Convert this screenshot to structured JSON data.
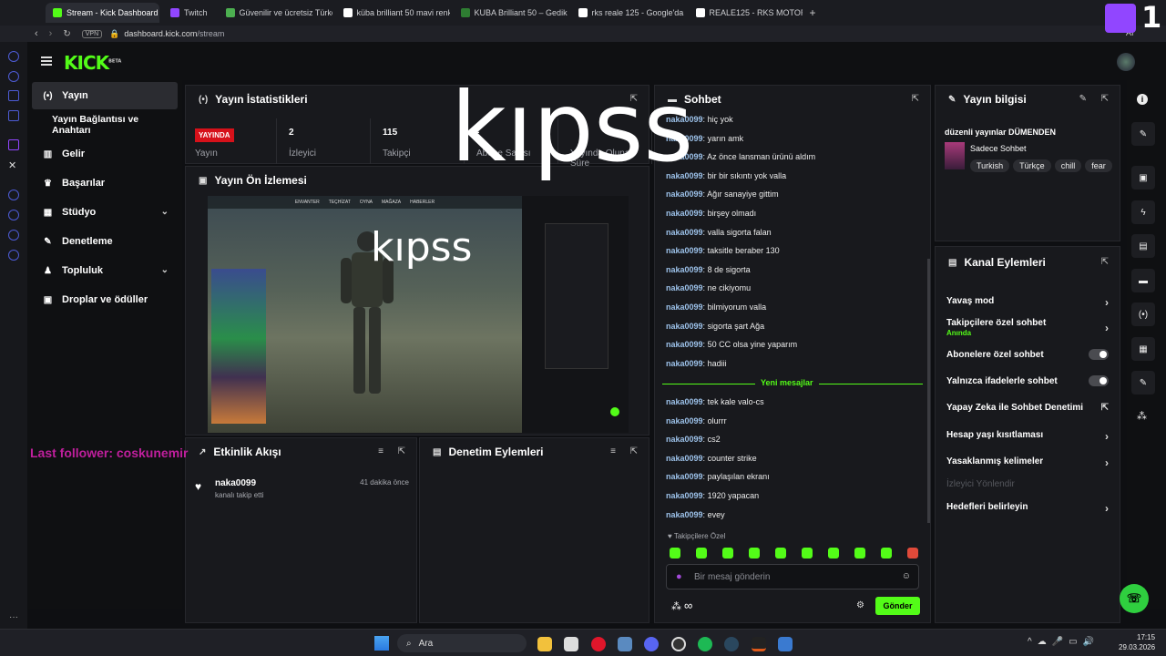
{
  "browser": {
    "tabs": [
      {
        "label": "Stream - Kick Dashboard",
        "active": true,
        "color": "#53fc18"
      },
      {
        "label": "Twitch",
        "active": false,
        "color": "#9146ff"
      },
      {
        "label": "Güvenilir ve ücretsiz Türkç",
        "active": false,
        "color": "#4caf50"
      },
      {
        "label": "küba brilliant 50 mavi renk",
        "active": false,
        "color": "#ffffff"
      },
      {
        "label": "KUBA Brilliant 50 – Gedikli",
        "active": false,
        "color": "#2e7d32"
      },
      {
        "label": "rks reale 125 - Google'da A",
        "active": false,
        "color": "#ffffff"
      },
      {
        "label": "REALE125 - RKS MOTOR",
        "active": false,
        "color": "#ffffff"
      }
    ],
    "vpn": "VPN",
    "url_host": "dashboard.kick.com",
    "url_path": "/stream",
    "ai_label": "AI"
  },
  "header": {
    "logo": "KICK",
    "beta": "BETA"
  },
  "nav": {
    "items": [
      {
        "label": "Yayın",
        "active": true,
        "icon": "broadcast-icon",
        "glyph": "(•)"
      },
      {
        "label": "Yayın Bağlantısı ve Anahtarı",
        "active": false,
        "icon": "",
        "glyph": ""
      },
      {
        "label": "Gelir",
        "active": false,
        "icon": "revenue-icon",
        "glyph": "▥"
      },
      {
        "label": "Başarılar",
        "active": false,
        "icon": "trophy-icon",
        "glyph": "♛"
      },
      {
        "label": "Stüdyo",
        "active": false,
        "icon": "studio-icon",
        "glyph": "▦",
        "chevron": "⌄"
      },
      {
        "label": "Denetleme",
        "active": false,
        "icon": "wrench-icon",
        "glyph": "✎"
      },
      {
        "label": "Topluluk",
        "active": false,
        "icon": "community-icon",
        "glyph": "♟",
        "chevron": "⌄"
      },
      {
        "label": "Droplar ve ödüller",
        "active": false,
        "icon": "drops-icon",
        "glyph": "▣"
      }
    ]
  },
  "stats": {
    "title": "Yayın İstatistikleri",
    "items": [
      {
        "value": "YAYINDA",
        "label": "Yayın",
        "badge": true
      },
      {
        "value": "2",
        "label": "İzleyici"
      },
      {
        "value": "115",
        "label": "Takipçi"
      },
      {
        "value": "-",
        "label": "Abone Sayısı"
      },
      {
        "value": "",
        "label": "Yayında Olunan Süre"
      }
    ]
  },
  "preview": {
    "title": "Yayın Ön İzlemesi",
    "hud_items": [
      "ENVANTER",
      "TEÇHİZAT",
      "OYNA",
      "MAĞAZA",
      "HABERLER"
    ]
  },
  "activity": {
    "title": "Etkinlik Akışı",
    "events": [
      {
        "user": "naka0099",
        "text": "kanalı takip etti",
        "time": "41 dakika önce"
      }
    ]
  },
  "moderation": {
    "title": "Denetim Eylemleri"
  },
  "chat": {
    "title": "Sohbet",
    "messages": [
      {
        "user": "naka0099",
        "text": "hiç yok"
      },
      {
        "user": "naka0099",
        "text": "yarın amk"
      },
      {
        "user": "naka0099",
        "text": "Az önce lansman ürünü aldım"
      },
      {
        "user": "naka0099",
        "text": "bir bir sıkıntı yok valla"
      },
      {
        "user": "naka0099",
        "text": "Ağır sanayiye gittim"
      },
      {
        "user": "naka0099",
        "text": "birşey olmadı"
      },
      {
        "user": "naka0099",
        "text": "valla sigorta falan"
      },
      {
        "user": "naka0099",
        "text": "taksitle beraber 130"
      },
      {
        "user": "naka0099",
        "text": "8 de sigorta"
      },
      {
        "user": "naka0099",
        "text": "ne cikiyomu"
      },
      {
        "user": "naka0099",
        "text": "bilmiyorum valla"
      },
      {
        "user": "naka0099",
        "text": "sigorta şart Ağa"
      },
      {
        "user": "naka0099",
        "text": "50 CC olsa yine yaparım"
      },
      {
        "user": "naka0099",
        "text": "hadiii"
      }
    ],
    "new_label": "Yeni mesajlar",
    "new_messages": [
      {
        "user": "naka0099",
        "text": "tek kale valo-cs"
      },
      {
        "user": "naka0099",
        "text": "olurrr"
      },
      {
        "user": "naka0099",
        "text": "cs2"
      },
      {
        "user": "naka0099",
        "text": "counter strike"
      },
      {
        "user": "naka0099",
        "text": "paylaşılan ekranı"
      },
      {
        "user": "naka0099",
        "text": "1920 yapacan"
      },
      {
        "user": "naka0099",
        "text": "evey"
      }
    ],
    "followers_only": "Takipçilere Özel",
    "placeholder": "Bir mesaj gönderin",
    "send": "Gönder",
    "infinity": "∞"
  },
  "stream_info": {
    "title": "Yayın bilgisi",
    "stream_title": "düzenli yayınlar DÜMENDEN",
    "category": "Sadece Sohbet",
    "tags": [
      "Turkish",
      "Türkçe",
      "chill",
      "fear"
    ]
  },
  "channel_actions": {
    "title": "Kanal Eylemleri",
    "rows": [
      {
        "label": "Yavaş mod",
        "control": "chevron"
      },
      {
        "label": "Takipçilere özel sohbet",
        "sub": "Anında",
        "control": "chevron"
      },
      {
        "label": "Abonelere özel sohbet",
        "control": "toggle"
      },
      {
        "label": "Yalnızca ifadelerle sohbet",
        "control": "toggle"
      },
      {
        "label": "Yapay Zeka ile Sohbet Denetimi",
        "control": "external"
      },
      {
        "label": "Hesap yaşı kısıtlaması",
        "control": "chevron"
      },
      {
        "label": "Yasaklanmış kelimeler",
        "control": "chevron"
      },
      {
        "label": "İzleyici Yönlendir",
        "control": "none",
        "disabled": true
      },
      {
        "label": "Hedefleri belirleyin",
        "control": "chevron"
      }
    ]
  },
  "overlays": {
    "big": "kıpss",
    "small": "kıpss",
    "last_follower": "Last follower: coskunemir",
    "badge_count": "1"
  },
  "taskbar": {
    "search": "Ara",
    "time": "17:15",
    "date": "29.03.2026"
  }
}
